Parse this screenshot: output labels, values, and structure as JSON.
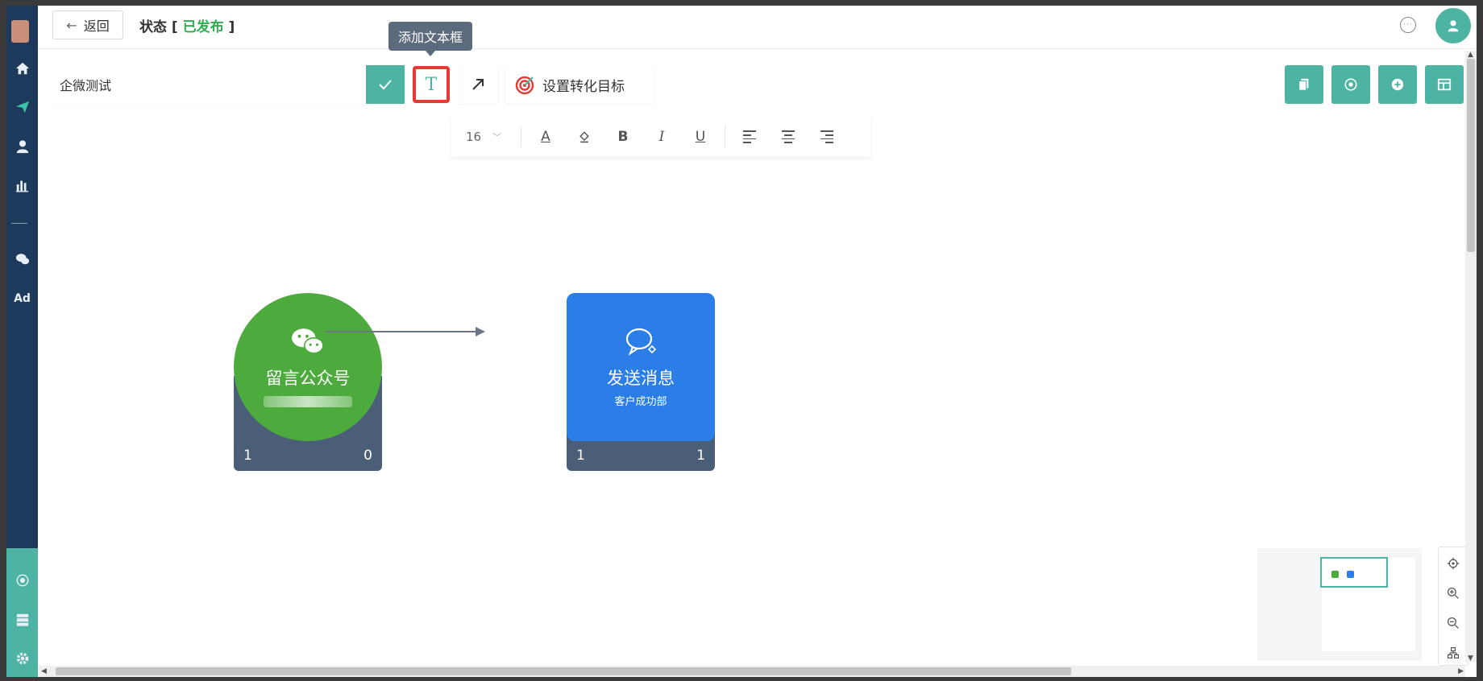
{
  "header": {
    "back_label": "返回",
    "status_prefix": "状态 [ ",
    "status_value": "已发布",
    "status_suffix": " ]"
  },
  "toolbar": {
    "name_value": "企微测试",
    "text_button_glyph": "T",
    "tooltip": "添加文本框",
    "goal_label": "设置转化目标"
  },
  "format_bar": {
    "font_size": "16",
    "color_glyph": "A",
    "bold_glyph": "B",
    "italic_glyph": "I",
    "underline_glyph": "U"
  },
  "nodes": [
    {
      "title": "留言公众号",
      "subtitle": "",
      "count_left": "1",
      "count_right": "0",
      "color": "#4dab3e"
    },
    {
      "title": "发送消息",
      "subtitle": "客户成功部",
      "count_left": "1",
      "count_right": "1",
      "color": "#2b7ee8"
    }
  ],
  "sidebar": {
    "ad_label": "Ad"
  },
  "colors": {
    "accent": "#4db3a2",
    "sidebar": "#1d3a5c",
    "published": "#2fae52",
    "highlight": "#e53935"
  }
}
